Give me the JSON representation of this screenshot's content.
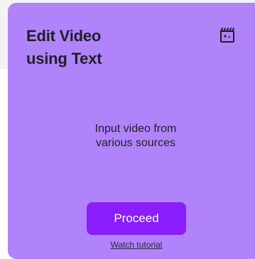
{
  "card": {
    "title_line1": "Edit Video",
    "title_line2": "using Text",
    "icon": "video-edit-clapperboard-icon",
    "description_line1": "Input video from",
    "description_line2": "various sources",
    "proceed_label": "Proceed",
    "tutorial_label": "Watch tutorial"
  },
  "colors": {
    "card_background": "#b083fb",
    "button_background": "#8a1dfb",
    "button_text": "#ffffff",
    "text": "#1f1f2b",
    "page_background": "#ffffff",
    "top_band": "#f3f3f5"
  }
}
